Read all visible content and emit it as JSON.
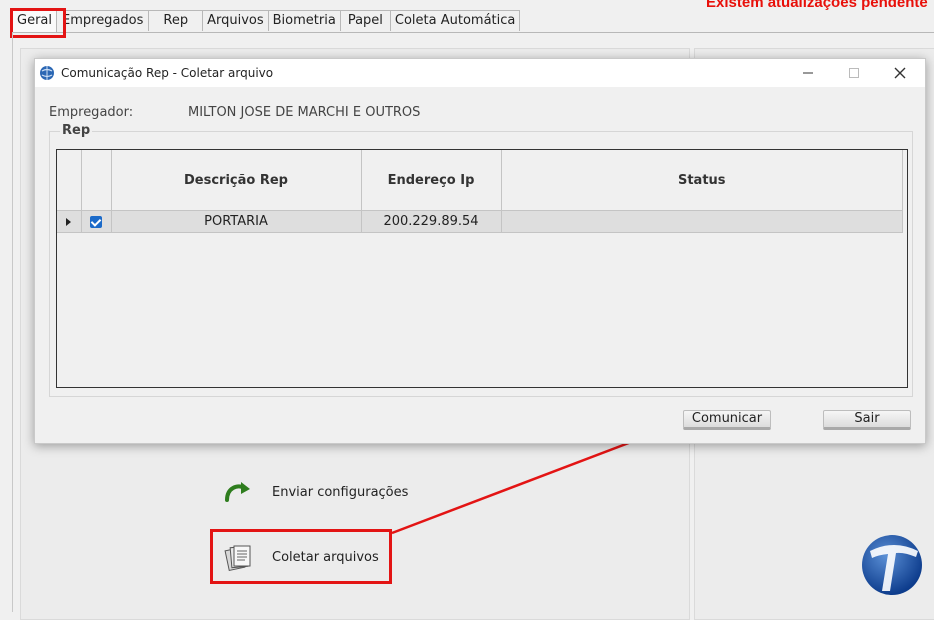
{
  "notice": "Existem atualizações pendente",
  "tabs": [
    "Geral",
    "Empregados",
    "Rep",
    "Arquivos",
    "Biometria",
    "Papel",
    "Coleta Automática"
  ],
  "actions": {
    "send_config": "Enviar configurações",
    "collect_files": "Coletar arquivos"
  },
  "dialog": {
    "title": "Comunicação Rep - Coletar arquivo",
    "employer_label": "Empregador:",
    "employer_value": "MILTON JOSE DE MARCHI E OUTROS",
    "group_title": "Rep",
    "columns": [
      "Descrição Rep",
      "Endereço Ip",
      "Status"
    ],
    "rows": [
      {
        "checked": true,
        "description": "PORTARIA",
        "ip": "200.229.89.54",
        "status": ""
      }
    ],
    "buttons": {
      "communicate": "Comunicar",
      "exit": "Sair"
    }
  },
  "colors": {
    "highlight": "#e31414",
    "accent": "#1b6ac9"
  }
}
